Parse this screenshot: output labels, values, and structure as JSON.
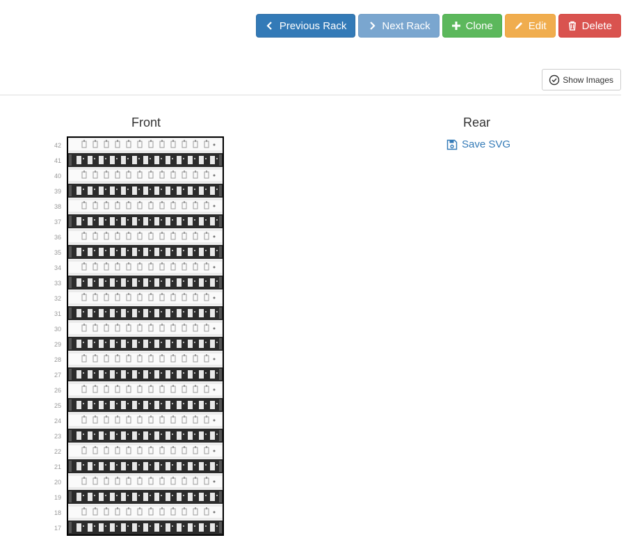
{
  "toolbar": {
    "prev_label": "Previous Rack",
    "next_label": "Next Rack",
    "clone_label": "Clone",
    "edit_label": "Edit",
    "delete_label": "Delete"
  },
  "show_images_label": "Show Images",
  "front_title": "Front",
  "rear_title": "Rear",
  "save_svg_label": "Save SVG",
  "rack": {
    "unit_numbers": [
      42,
      41,
      40,
      39,
      38,
      37,
      36,
      35,
      34,
      33,
      32,
      31,
      30,
      29,
      28,
      27,
      26,
      25,
      24,
      23,
      22,
      21,
      20,
      19,
      18,
      17
    ],
    "unit_types": [
      "patch",
      "switch",
      "patch",
      "switch",
      "patch",
      "switch",
      "patch",
      "switch",
      "patch",
      "switch",
      "patch",
      "switch",
      "patch",
      "switch",
      "patch",
      "switch",
      "patch",
      "switch",
      "patch",
      "switch",
      "patch",
      "switch",
      "patch",
      "switch",
      "patch",
      "switch"
    ]
  },
  "colors": {
    "primary": "#337ab7",
    "success": "#5cb85c",
    "warning": "#f0ad4e",
    "danger": "#d9534f"
  }
}
